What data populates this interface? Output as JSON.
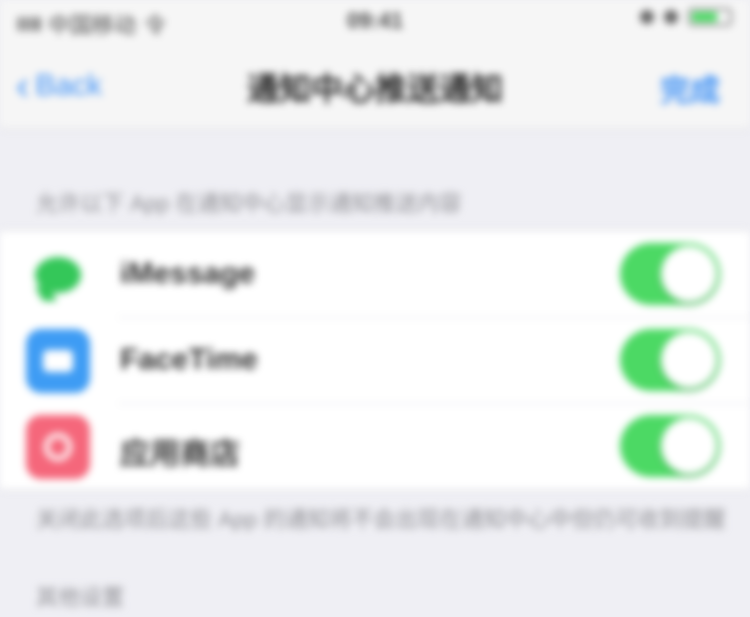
{
  "status_bar": {
    "carrier": "中国移动",
    "network": "令",
    "time": "09:41",
    "battery_color": "#4cd964",
    "battery_level": 0.7
  },
  "nav": {
    "back_label": "Back",
    "title": "通知中心推送通知",
    "action_label": "完成"
  },
  "section": {
    "header": "允许以下 App 在通知中心显示通知推送内容",
    "items": [
      {
        "icon": "messages-icon",
        "label": "iMessage",
        "enabled": true
      },
      {
        "icon": "camera-app-icon",
        "label": "FaceTime",
        "enabled": true
      },
      {
        "icon": "flower-app-icon",
        "label": "应用商店",
        "enabled": true
      }
    ],
    "footer": "关闭此选项后这些 App 的通知将不会出现在通知中心中但仍可收到提醒",
    "next_header": "其他设置"
  },
  "colors": {
    "accent": "#3b8ff5",
    "toggle_on": "#4cd964",
    "background": "#efeff4"
  }
}
